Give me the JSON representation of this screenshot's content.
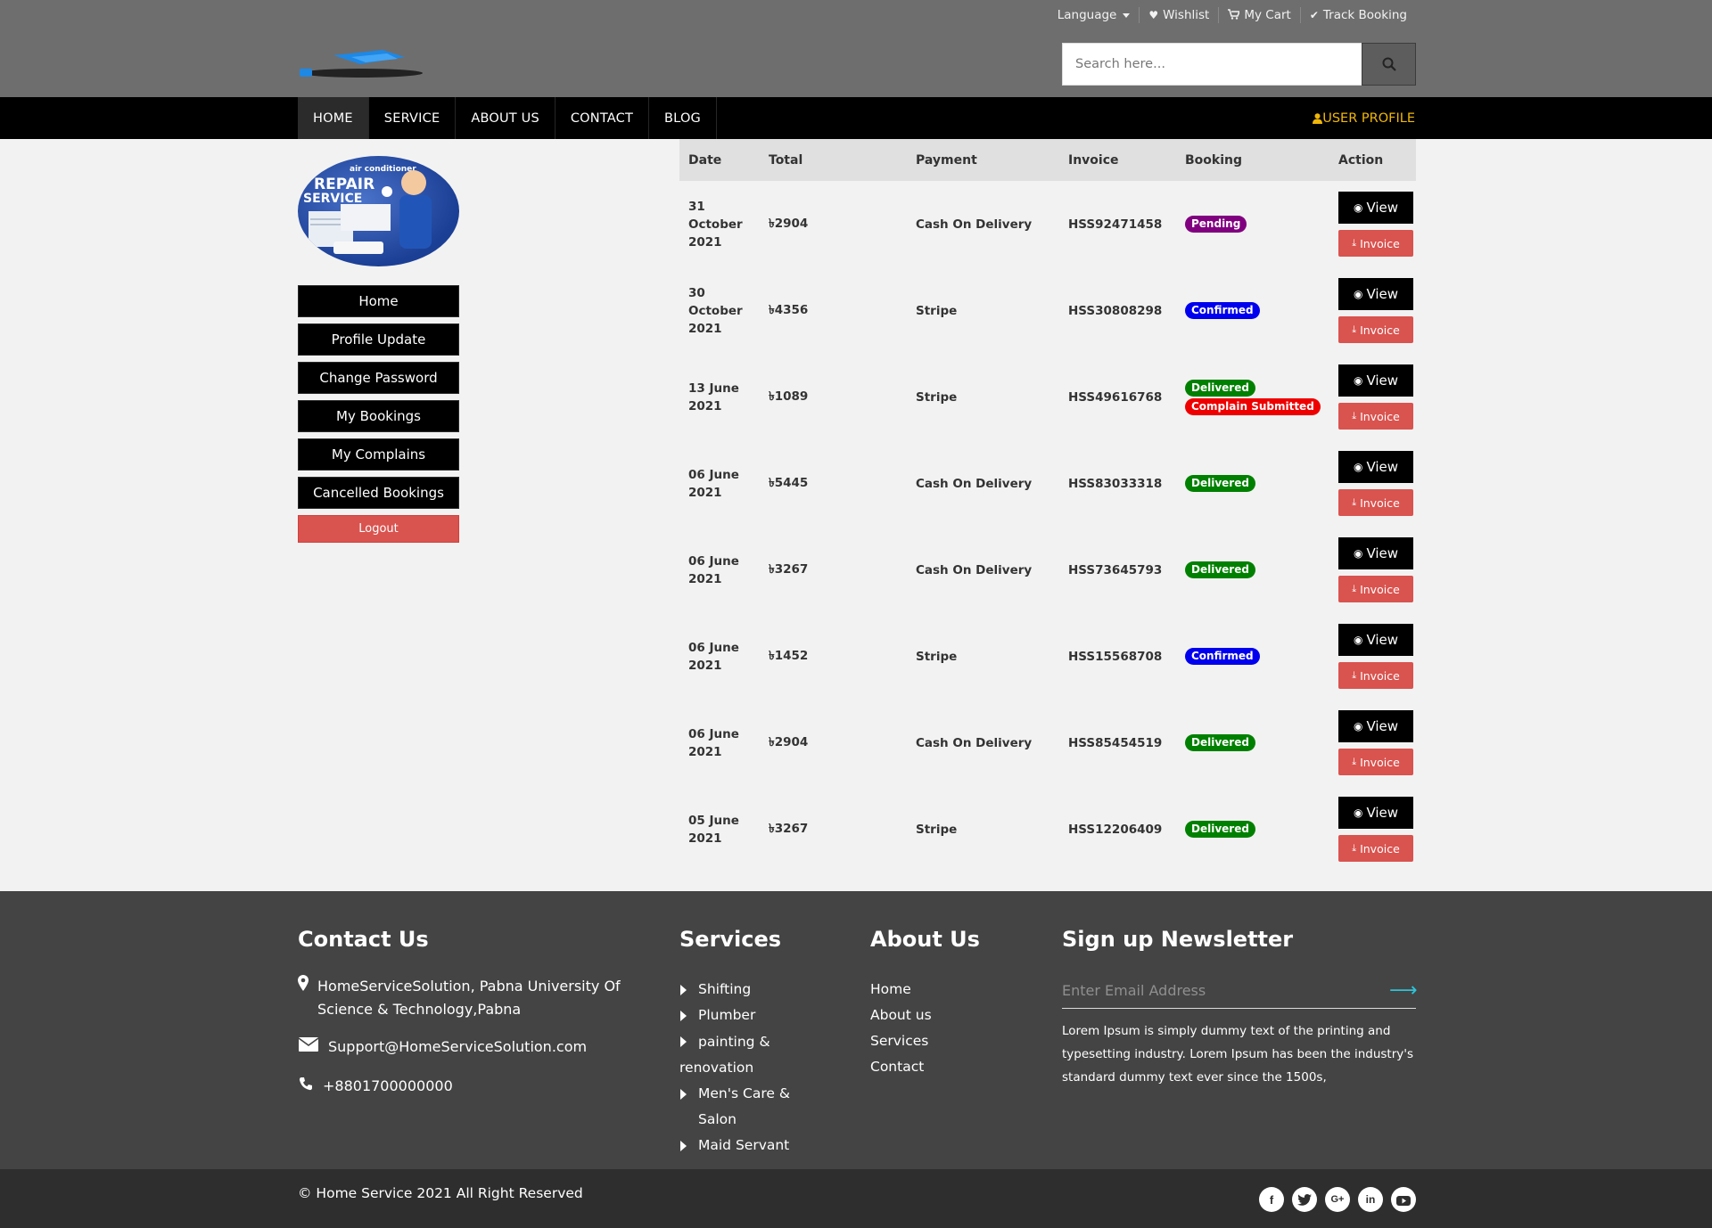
{
  "header": {
    "toplinks": [
      {
        "label": "Language",
        "icon": "language-dropdown"
      },
      {
        "label": "Wishlist",
        "icon": "heart-icon"
      },
      {
        "label": "My Cart",
        "icon": "cart-icon"
      },
      {
        "label": "Track Booking",
        "icon": "check-icon"
      }
    ],
    "search_placeholder": "Search here...",
    "nav": [
      "HOME",
      "SERVICE",
      "ABOUT US",
      "CONTACT",
      "BLOG"
    ],
    "user_profile": "USER PROFILE"
  },
  "sidebar": {
    "avatar_text_top": "air conditioner",
    "avatar_text_main": "REPAIR",
    "avatar_text_sub": "SERVICE",
    "items": [
      "Home",
      "Profile Update",
      "Change Password",
      "My Bookings",
      "My Complains",
      "Cancelled Bookings"
    ],
    "logout": "Logout"
  },
  "table": {
    "headers": [
      "Date",
      "Total",
      "Payment",
      "Invoice",
      "Booking",
      "Action"
    ],
    "view_label": "View",
    "invoice_label": "Invoice",
    "rows": [
      {
        "date": "31 October 2021",
        "total": "৳2904",
        "payment": "Cash On Delivery",
        "invoice": "HSS92471458",
        "badges": [
          {
            "text": "Pending",
            "kind": "pending"
          }
        ]
      },
      {
        "date": "30 October 2021",
        "total": "৳4356",
        "payment": "Stripe",
        "invoice": "HSS30808298",
        "badges": [
          {
            "text": "Confirmed",
            "kind": "confirmed"
          }
        ]
      },
      {
        "date": "13 June 2021",
        "total": "৳1089",
        "payment": "Stripe",
        "invoice": "HSS49616768",
        "badges": [
          {
            "text": "Delivered",
            "kind": "delivered"
          },
          {
            "text": "Complain Submitted",
            "kind": "complain"
          }
        ]
      },
      {
        "date": "06 June 2021",
        "total": "৳5445",
        "payment": "Cash On Delivery",
        "invoice": "HSS83033318",
        "badges": [
          {
            "text": "Delivered",
            "kind": "delivered"
          }
        ]
      },
      {
        "date": "06 June 2021",
        "total": "৳3267",
        "payment": "Cash On Delivery",
        "invoice": "HSS73645793",
        "badges": [
          {
            "text": "Delivered",
            "kind": "delivered"
          }
        ]
      },
      {
        "date": "06 June 2021",
        "total": "৳1452",
        "payment": "Stripe",
        "invoice": "HSS15568708",
        "badges": [
          {
            "text": "Confirmed",
            "kind": "confirmed"
          }
        ]
      },
      {
        "date": "06 June 2021",
        "total": "৳2904",
        "payment": "Cash On Delivery",
        "invoice": "HSS85454519",
        "badges": [
          {
            "text": "Delivered",
            "kind": "delivered"
          }
        ]
      },
      {
        "date": "05 June 2021",
        "total": "৳3267",
        "payment": "Stripe",
        "invoice": "HSS12206409",
        "badges": [
          {
            "text": "Delivered",
            "kind": "delivered"
          }
        ]
      }
    ]
  },
  "footer": {
    "contact_title": "Contact Us",
    "address": "HomeServiceSolution, Pabna University Of Science & Technology,Pabna",
    "email": "Support@HomeServiceSolution.com",
    "phone": "+8801700000000",
    "services_title": "Services",
    "services": [
      "Shifting",
      "Plumber",
      "painting & renovation",
      "Men's Care & Salon",
      "Maid Servant"
    ],
    "about_title": "About Us",
    "about_links": [
      "Home",
      "About us",
      "Services",
      "Contact"
    ],
    "newsletter_title": "Sign up Newsletter",
    "newsletter_placeholder": "Enter Email Address",
    "newsletter_text": "Lorem Ipsum is simply dummy text of the printing and typesetting industry. Lorem Ipsum has been the industry's standard dummy text ever since the 1500s,",
    "copyright": "© Home Service 2021 All Right Reserved",
    "socials": [
      "facebook-icon",
      "twitter-icon",
      "google-plus-icon",
      "linkedin-icon",
      "youtube-icon"
    ]
  },
  "colors": {
    "header_bg": "#6e6e6e",
    "nav_bg": "#000000",
    "accent_gold": "#f0b70a",
    "danger": "#d9534f",
    "pending": "#800080",
    "confirmed": "#0000ee",
    "delivered": "#008000",
    "complain": "#ee0000"
  }
}
